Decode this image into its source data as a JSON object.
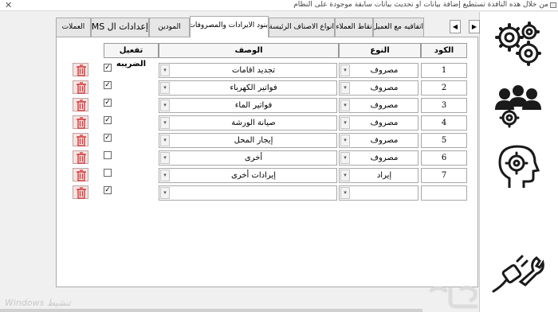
{
  "window": {
    "title": "من خلال هذه النافذة تستطيع إضافة بيانات او تحديث بيانات سابقة موجودة على النظام"
  },
  "tabs": [
    {
      "label": "العملات",
      "active": false
    },
    {
      "label": "إعدادات ال SMS",
      "active": false
    },
    {
      "label": "المودين",
      "active": false
    },
    {
      "label": "بنود الايرادات والمصروفات",
      "active": true
    },
    {
      "label": "انواع الاصناف الرئيسة والفرعيه",
      "active": false
    },
    {
      "label": "نقاط العملاء",
      "active": false
    },
    {
      "label": "اتفاقيه مع العميل",
      "active": false
    }
  ],
  "nav_icons": [
    "gears-icon",
    "users-settings-icon",
    "head-gear-icon",
    "plug-wrench-icon"
  ],
  "grid": {
    "headers": {
      "code": "الكود",
      "type": "النوع",
      "description": "الوصف",
      "tax": "تفعيل الضريبه"
    },
    "rows": [
      {
        "code": "1",
        "type": "مصروف",
        "description": "تجديد اقامات",
        "tax_enabled": true
      },
      {
        "code": "2",
        "type": "مصروف",
        "description": "فواتير الكهرباء",
        "tax_enabled": true
      },
      {
        "code": "3",
        "type": "مصروف",
        "description": "فواتير الماء",
        "tax_enabled": true
      },
      {
        "code": "4",
        "type": "مصروف",
        "description": "صيانة الورشة",
        "tax_enabled": true
      },
      {
        "code": "5",
        "type": "مصروف",
        "description": "إيجار المحل",
        "tax_enabled": true
      },
      {
        "code": "6",
        "type": "مصروف",
        "description": "أخرى",
        "tax_enabled": false
      },
      {
        "code": "7",
        "type": "إيراد",
        "description": "إيرادات أخرى",
        "tax_enabled": false
      },
      {
        "code": "",
        "type": "",
        "description": "",
        "tax_enabled": true
      }
    ]
  },
  "watermark": {
    "text": "Windows تنشيط"
  },
  "colors": {
    "trash": "#d33c3c",
    "window_bg": "#f0f0f0",
    "content_bg": "#ffffff"
  }
}
